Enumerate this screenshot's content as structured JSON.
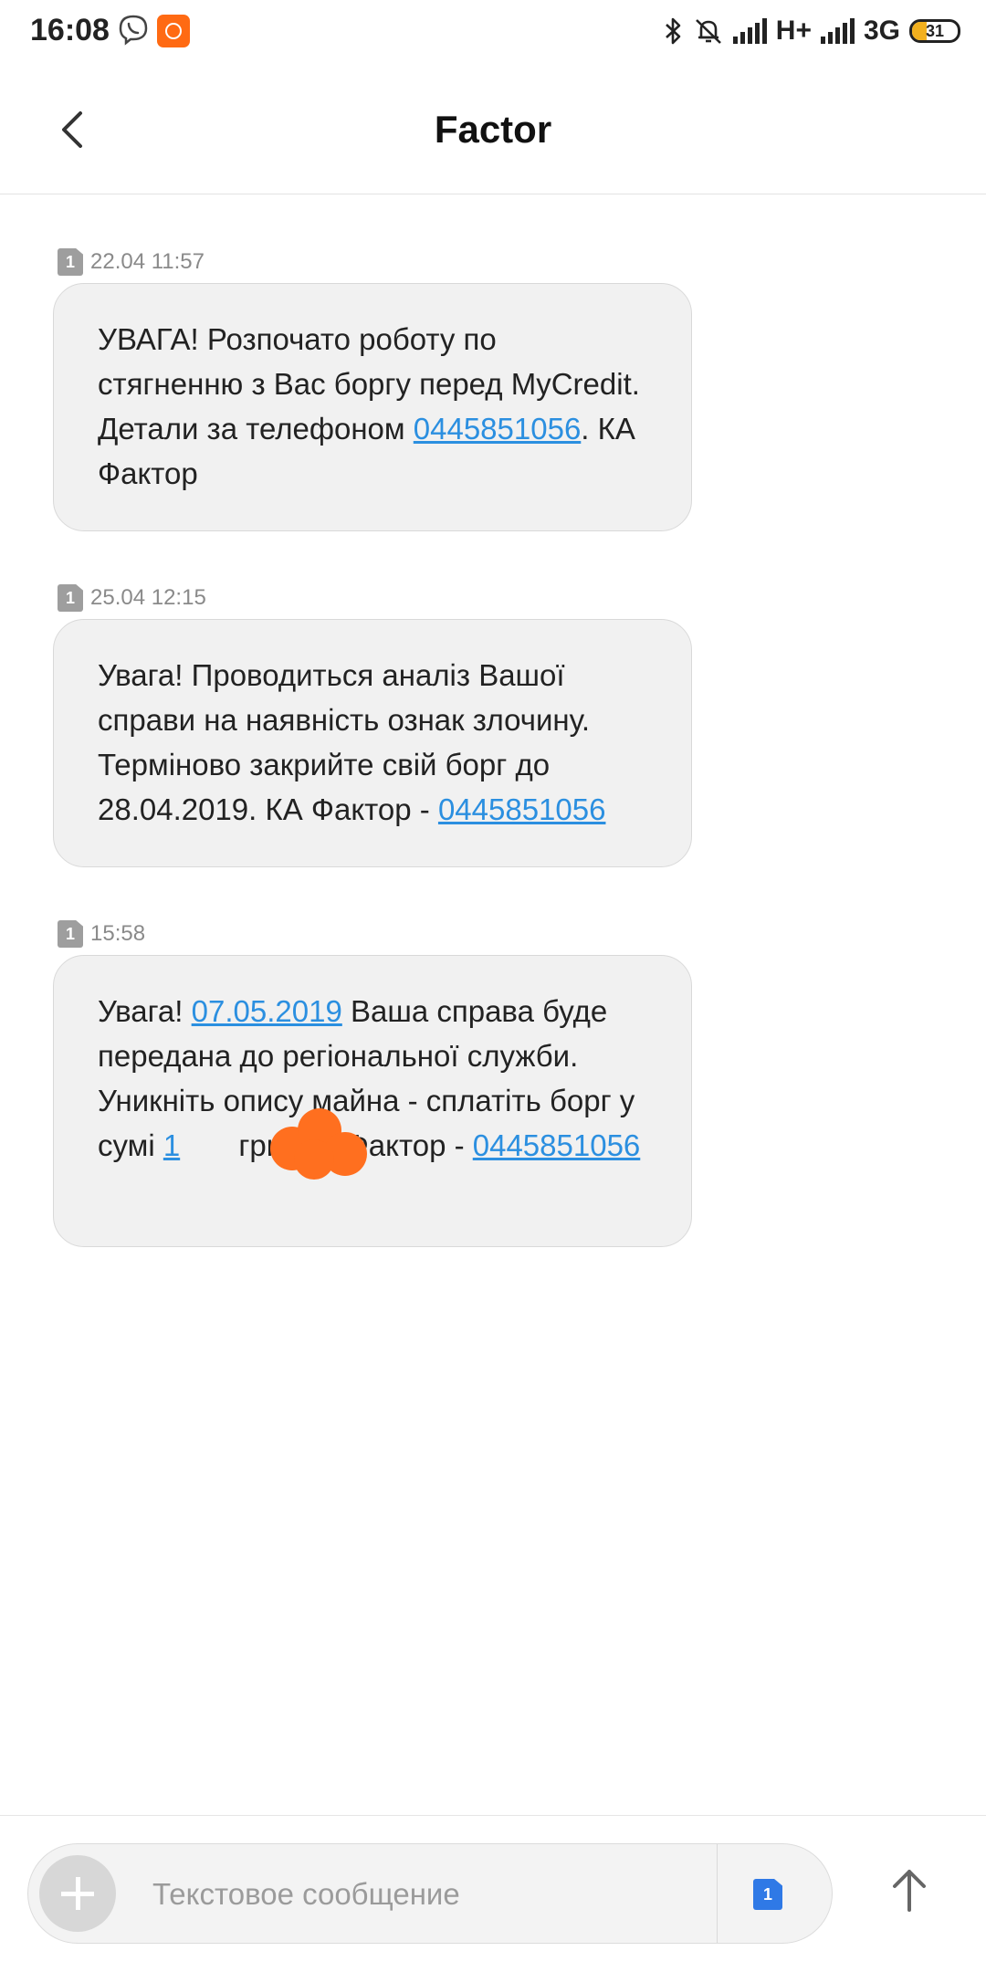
{
  "status_bar": {
    "time": "16:08",
    "network_primary": "H+",
    "network_secondary": "3G",
    "battery_level": "31",
    "icons": [
      "viber-icon",
      "app-notification-icon",
      "bluetooth-icon",
      "silent-icon",
      "signal-icon",
      "signal-icon",
      "battery-icon"
    ]
  },
  "header": {
    "title": "Factor",
    "back_icon": "chevron-left-icon"
  },
  "messages": [
    {
      "sim": "1",
      "timestamp": "22.04 11:57",
      "segments": [
        {
          "text": "УВАГА! Розпочато роботу по стягненню з Вас боргу перед MyCredit. Детали за телефоном ",
          "link": false
        },
        {
          "text": "0445851056",
          "link": true
        },
        {
          "text": ". КА Фактор",
          "link": false
        }
      ]
    },
    {
      "sim": "1",
      "timestamp": "25.04 12:15",
      "segments": [
        {
          "text": "Увага! Проводиться аналіз Вашої справи на наявність ознак злочину. Терміново закрийте свій борг до 28.04.2019. КА Фактор - ",
          "link": false
        },
        {
          "text": "0445851056",
          "link": true
        }
      ]
    },
    {
      "sim": "1",
      "timestamp": "15:58",
      "segments": [
        {
          "text": "Увага! ",
          "link": false
        },
        {
          "text": "07.05.2019",
          "link": true
        },
        {
          "text": " Ваша справа буде передана до регіональної служби. Уникніть опису майна - сплатіть борг у сумі ",
          "link": false
        },
        {
          "text": "1",
          "link": true
        },
        {
          "text": "       грн. КА Фактор - ",
          "link": false
        },
        {
          "text": "0445851056",
          "link": true
        }
      ]
    }
  ],
  "composer": {
    "placeholder": "Текстовое сообщение",
    "sim_label": "1",
    "add_icon": "plus-icon",
    "send_icon": "arrow-up-icon"
  },
  "colors": {
    "link": "#2b8fe0",
    "bubble": "#f1f1f1",
    "redaction": "#ff6f1f",
    "sim_active": "#2f79e6"
  }
}
